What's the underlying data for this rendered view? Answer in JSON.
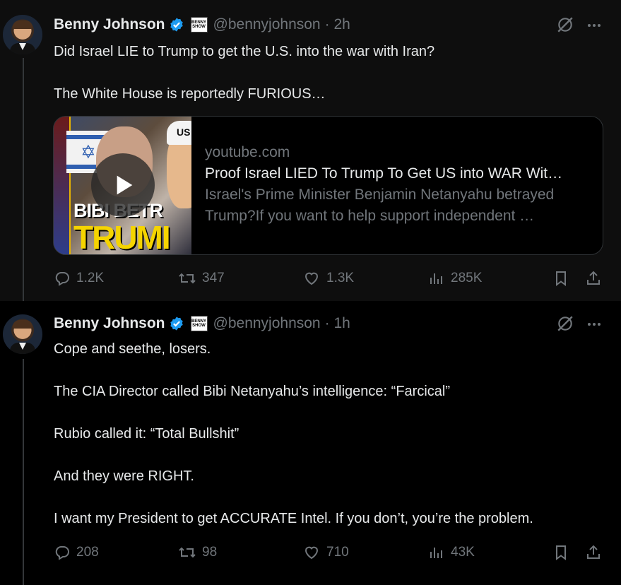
{
  "tweets": [
    {
      "author": "Benny Johnson",
      "handle": "@bennyjohnson",
      "time": "· 2h",
      "badge_text": [
        "BENNY",
        "SHOW"
      ],
      "text": [
        "Did Israel LIE to Trump to get the U.S. into the war with Iran?",
        "The White House is reportedly FURIOUS…"
      ],
      "card": {
        "domain": "youtube.com",
        "title": "Proof Israel LIED To Trump To Get US into WAR Wit…",
        "description": "Israel's Prime Minister Benjamin Netanyahu betrayed Trump?If you want to help support independent …",
        "thumb_line1": "BIBI BETR",
        "thumb_line2": "TRUMI",
        "thumb_cap": "US"
      },
      "replies": "1.2K",
      "reposts": "347",
      "likes": "1.3K",
      "views": "285K"
    },
    {
      "author": "Benny Johnson",
      "handle": "@bennyjohnson",
      "time": "· 1h",
      "badge_text": [
        "BENNY",
        "SHOW"
      ],
      "text": [
        "Cope and seethe, losers.",
        "The CIA Director called Bibi Netanyahu’s intelligence: “Farcical”",
        "Rubio called it: “Total Bullshit”",
        "And they were RIGHT.",
        "I want my President to get ACCURATE Intel. If you don’t, you’re the problem."
      ],
      "replies": "208",
      "reposts": "98",
      "likes": "710",
      "views": "43K"
    }
  ],
  "colors": {
    "background": "#000000",
    "text": "#e7e9ea",
    "secondary_text": "#71767b",
    "verified_blue": "#1d9bf0",
    "border": "#2f3336"
  },
  "icons": [
    "verified-icon",
    "grok-icon",
    "more-icon",
    "reply-icon",
    "repost-icon",
    "like-icon",
    "views-icon",
    "bookmark-icon",
    "share-icon",
    "play-icon"
  ]
}
